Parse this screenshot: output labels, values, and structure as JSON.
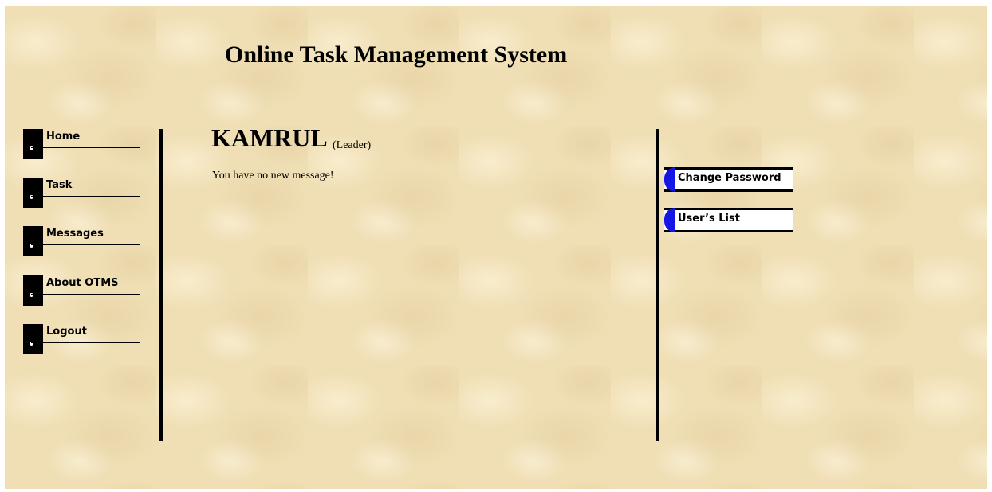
{
  "header": {
    "title": "Online Task Management System"
  },
  "nav": {
    "items": [
      {
        "label": "Home"
      },
      {
        "label": "Task"
      },
      {
        "label": "Messages"
      },
      {
        "label": "About OTMS"
      },
      {
        "label": "Logout"
      }
    ]
  },
  "main": {
    "user_name": "KAMRUL",
    "user_role": "(Leader)",
    "message": "You have no new message!"
  },
  "right_menu": {
    "items": [
      {
        "label": "Change Password"
      },
      {
        "label": "User’s List"
      }
    ]
  },
  "colors": {
    "background": "#f0dfb5",
    "accent": "#1515e6",
    "text": "#000000"
  }
}
